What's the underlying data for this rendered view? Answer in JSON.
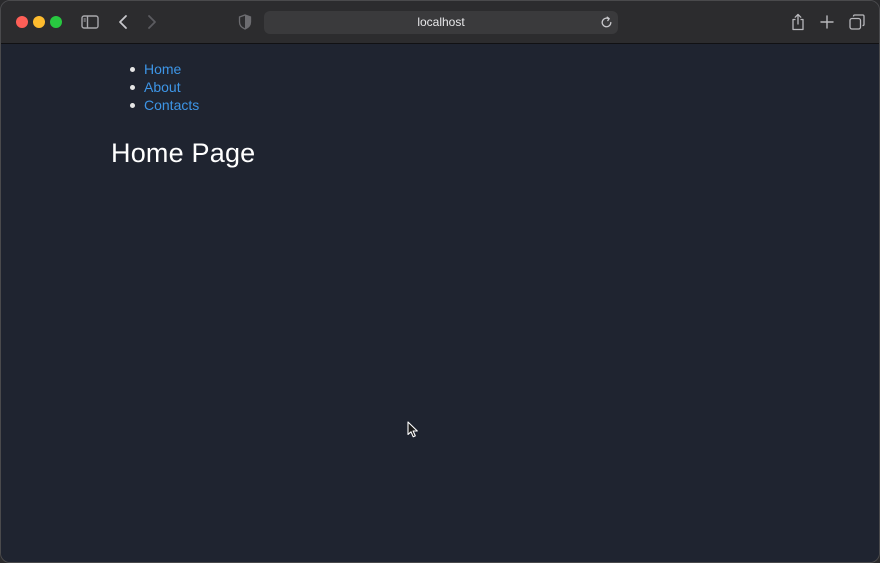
{
  "window": {
    "address": "localhost"
  },
  "nav": {
    "items": [
      {
        "label": "Home"
      },
      {
        "label": "About"
      },
      {
        "label": "Contacts"
      }
    ]
  },
  "main": {
    "title": "Home Page"
  },
  "colors": {
    "background": "#1f2430",
    "link": "#3d95e6",
    "heading": "#ffffff",
    "toolbar": "#2c2c2e"
  },
  "icons": {
    "toolbar": [
      "sidebar-icon",
      "back-arrow-icon",
      "forward-arrow-icon",
      "shield-icon",
      "reload-icon",
      "share-icon",
      "plus-icon",
      "tabs-overview-icon"
    ]
  }
}
